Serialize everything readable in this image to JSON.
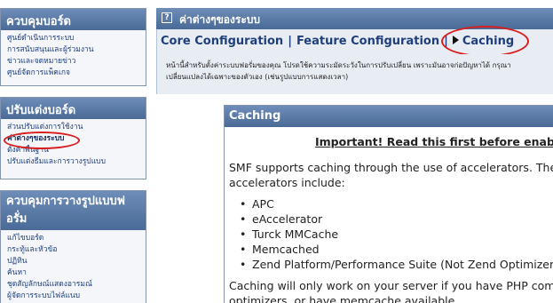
{
  "sidebar": {
    "admin": {
      "title": "ควบคุมบอร์ด",
      "links": [
        "ศูนย์ดำเนินการระบบ",
        "การสนับสนุนและผู้ร่วมงาน",
        "ข่าวและจดหมายข่าว",
        "ศูนย์จัดการแพ็คเกจ"
      ]
    },
    "config": {
      "title": "ปรับแต่งบอร์ด",
      "links": [
        "ส่วนปรับแต่งการใช้งาน",
        "ค่าต่างๆของระบบ",
        "ตั้งค่าพื้นฐาน",
        "ปรับแต่งธีมและการวางรูปแบบ"
      ]
    },
    "layout": {
      "title": "ควบคุมการวางรูปแบบฟอรั่ม",
      "links": [
        "แก้ไขบอร์ด",
        "กระทู้และหัวข้อ",
        "ปฏิทิน",
        "ค้นหา",
        "ชุดสัญลักษณ์แสดงอารมณ์",
        "ผู้จัดการระบบไฟล์แนบ"
      ]
    }
  },
  "main": {
    "header_title": "ค่าต่างๆของระบบ",
    "help_icon_text": "?",
    "tabs": [
      "Core Configuration",
      "Feature Configuration",
      "Caching"
    ],
    "tab_separator": "|",
    "description": [
      "หน้านี้สำหรับตั้งค่าระบบฟอรั่มของคุณ โปรดใช้ความระมัดระวังในการปรับเปลี่ยน เพราะมันอาจก่อปัญหาได้ กรุณา",
      "เปลี่ยนแปลงได้เฉพาะของตัวเอง (เช่นรูปแบบการแสดงเวลา)"
    ]
  },
  "section": {
    "title": "Caching",
    "important": "Important! Read this first before enabling",
    "intro_1": "SMF supports caching through the use of accelerators. The",
    "intro_2": "accelerators include:",
    "accelerators": [
      "APC",
      "eAccelerator",
      "Turck MMCache",
      "Memcached",
      "Zend Platform/Performance Suite (Not Zend Optimizer)"
    ],
    "outro_1": "Caching will only work on your server if you have PHP compiled with",
    "outro_2": "optimizers, or have memcache available."
  },
  "colors": {
    "header_gradient_top": "#6e8db8",
    "header_gradient_bottom": "#4a6a97",
    "link": "#1f3f7c",
    "highlight_ring": "#d91e1e"
  }
}
